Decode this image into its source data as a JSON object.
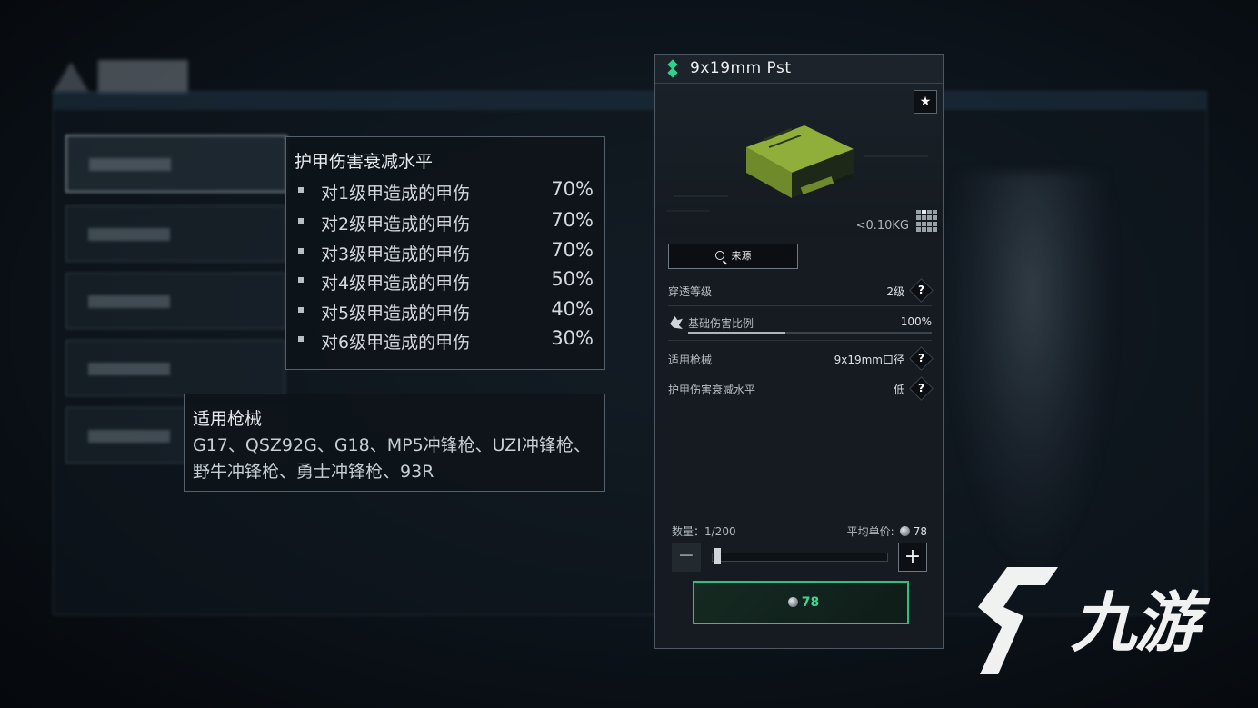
{
  "armor_tooltip": {
    "title": "护甲伤害衰减水平",
    "rows": [
      {
        "label": "对1级甲造成的甲伤",
        "value": "70%"
      },
      {
        "label": "对2级甲造成的甲伤",
        "value": "70%"
      },
      {
        "label": "对3级甲造成的甲伤",
        "value": "70%"
      },
      {
        "label": "对4级甲造成的甲伤",
        "value": "50%"
      },
      {
        "label": "对5级甲造成的甲伤",
        "value": "40%"
      },
      {
        "label": "对6级甲造成的甲伤",
        "value": "30%"
      }
    ]
  },
  "weapons_tooltip": {
    "title": "适用枪械",
    "text": "G17、QSZ92G、G18、MP5冲锋枪、UZI冲锋枪、野牛冲锋枪、勇士冲锋枪、93R"
  },
  "item": {
    "name": "9x19mm Pst",
    "weight": "<0.10KG",
    "source_label": "来源",
    "stats": [
      {
        "label": "穿透等级",
        "value": "2级"
      },
      {
        "label": "基础伤害比例",
        "value": "100%",
        "fraction": 0.4
      },
      {
        "label": "适用枪械",
        "value": "9x19mm口径"
      },
      {
        "label": "护甲伤害衰减水平",
        "value": "低"
      }
    ],
    "quantity_label": "数量：1/200",
    "quantity_fraction": 0.005,
    "avg_price_label": "平均单价:",
    "avg_price": "78",
    "buy_price": "78",
    "help_glyph": "?"
  },
  "watermark": {
    "text": "九游"
  },
  "colors": {
    "accent": "#2fd08c",
    "buy": "#38d98f"
  }
}
